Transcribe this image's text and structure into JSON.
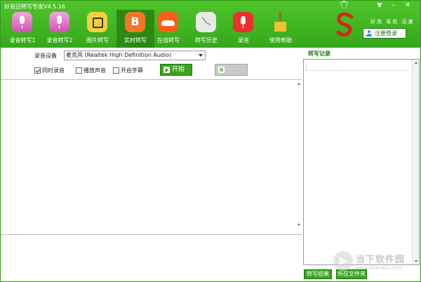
{
  "window": {
    "title": "好易迅转写专家V4.5.16"
  },
  "toolbar": {
    "items": [
      {
        "label": "录音转写1",
        "icon": "microphone-pink-icon"
      },
      {
        "label": "录音转写2",
        "icon": "microphone-pink-icon"
      },
      {
        "label": "图片转写",
        "icon": "image-icon"
      },
      {
        "label": "实时转写",
        "icon": "blogger-icon",
        "active": true
      },
      {
        "label": "在线转写",
        "icon": "cloud-icon"
      },
      {
        "label": "转写历史",
        "icon": "clock-icon"
      },
      {
        "label": "录音",
        "icon": "record-mic-icon"
      },
      {
        "label": "使用帮助",
        "icon": "broom-icon"
      }
    ]
  },
  "brand": {
    "slogan": "好用 易用 迅速",
    "register_label": "注册登录"
  },
  "controls": {
    "device_label": "录音设备",
    "device_value": "麦克风 (Realtek High Definition Audio)",
    "checkboxes": [
      {
        "label": "同时录音",
        "checked": true
      },
      {
        "label": "播放声音",
        "checked": false
      },
      {
        "label": "开启字幕",
        "checked": false
      }
    ],
    "start_label": "开始",
    "stop_label": ""
  },
  "records": {
    "label": "转写记录"
  },
  "result_buttons": {
    "result_label": "转写结果",
    "folder_label": "所在文件夹"
  },
  "watermark": {
    "text": "当下软件园",
    "url": "www.downxia.com"
  },
  "colors": {
    "header_green": "#3db21f",
    "active_tab": "#2c8a14",
    "button_green": "#3aa51f"
  }
}
